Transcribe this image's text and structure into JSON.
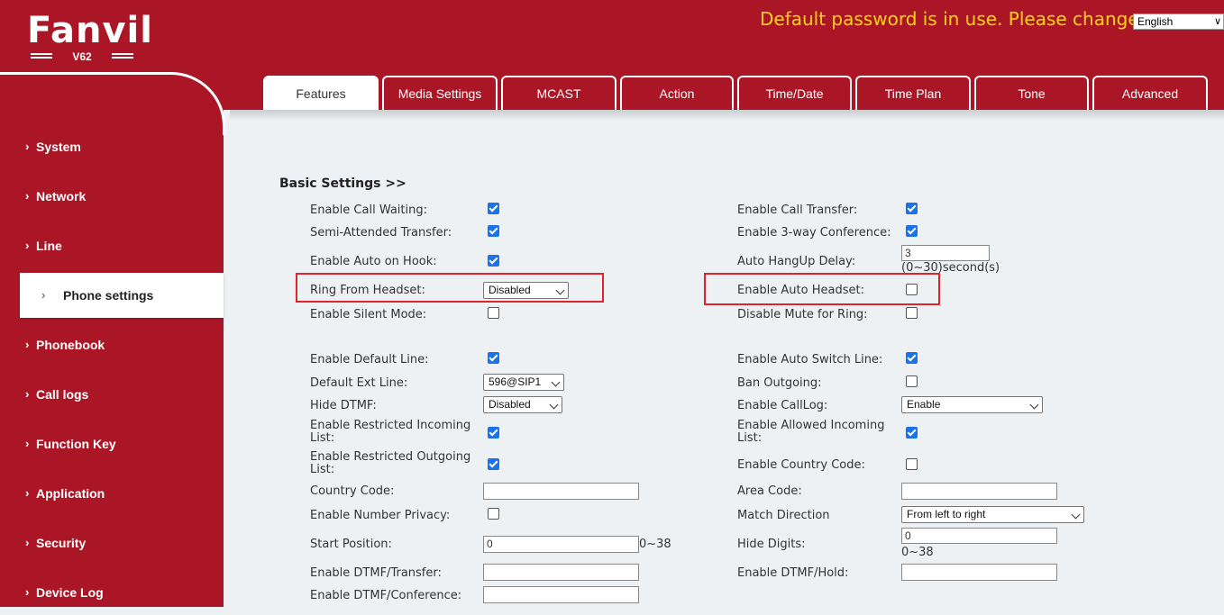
{
  "header": {
    "logo_text": "Fanvil",
    "model": "V62",
    "warning": "Default password is in use. Please change",
    "language": "English"
  },
  "tabs": [
    "Features",
    "Media Settings",
    "MCAST",
    "Action",
    "Time/Date",
    "Time Plan",
    "Tone",
    "Advanced"
  ],
  "active_tab": "Features",
  "sidebar": {
    "items": [
      "System",
      "Network",
      "Line",
      "Phone settings",
      "Phonebook",
      "Call logs",
      "Function Key",
      "Application",
      "Security",
      "Device Log"
    ],
    "active": "Phone settings"
  },
  "section_title": "Basic Settings >>",
  "left": {
    "call_waiting": "Enable Call Waiting:",
    "semi_attended": "Semi-Attended Transfer:",
    "auto_on_hook": "Enable Auto on Hook:",
    "ring_from_headset": "Ring From Headset:",
    "ring_from_headset_value": "Disabled",
    "silent_mode": "Enable Silent Mode:",
    "default_line": "Enable Default Line:",
    "default_ext_line": "Default Ext Line:",
    "default_ext_line_value": "596@SIP1",
    "hide_dtmf": "Hide DTMF:",
    "hide_dtmf_value": "Disabled",
    "restricted_incoming": "Enable Restricted Incoming List:",
    "restricted_outgoing": "Enable Restricted Outgoing List:",
    "country_code": "Country Code:",
    "number_privacy": "Enable Number Privacy:",
    "start_position": "Start Position:",
    "start_position_value": "0",
    "start_position_range": "0~38",
    "dtmf_transfer": "Enable DTMF/Transfer:",
    "dtmf_conference": "Enable DTMF/Conference:"
  },
  "right": {
    "call_transfer": "Enable Call Transfer:",
    "three_way": "Enable 3-way Conference:",
    "auto_hangup_delay": "Auto HangUp Delay:",
    "auto_hangup_value": "3",
    "auto_hangup_unit": "(0~30)second(s)",
    "auto_headset": "Enable Auto Headset:",
    "disable_mute_ring": "Disable Mute for Ring:",
    "auto_switch_line": "Enable Auto Switch Line:",
    "ban_outgoing": "Ban Outgoing:",
    "calllog": "Enable CallLog:",
    "calllog_value": "Enable",
    "allowed_incoming": "Enable Allowed Incoming List:",
    "country_code_enable": "Enable Country Code:",
    "area_code": "Area Code:",
    "match_direction": "Match Direction",
    "match_direction_value": "From left to right",
    "hide_digits": "Hide Digits:",
    "hide_digits_value": "0",
    "hide_digits_range": "0~38",
    "dtmf_hold": "Enable DTMF/Hold:"
  },
  "colors": {
    "brand_red": "#ab1626",
    "warning_yellow": "#ffd21a",
    "checkbox_blue": "#1a73e8",
    "highlight_red": "#e0242c"
  }
}
